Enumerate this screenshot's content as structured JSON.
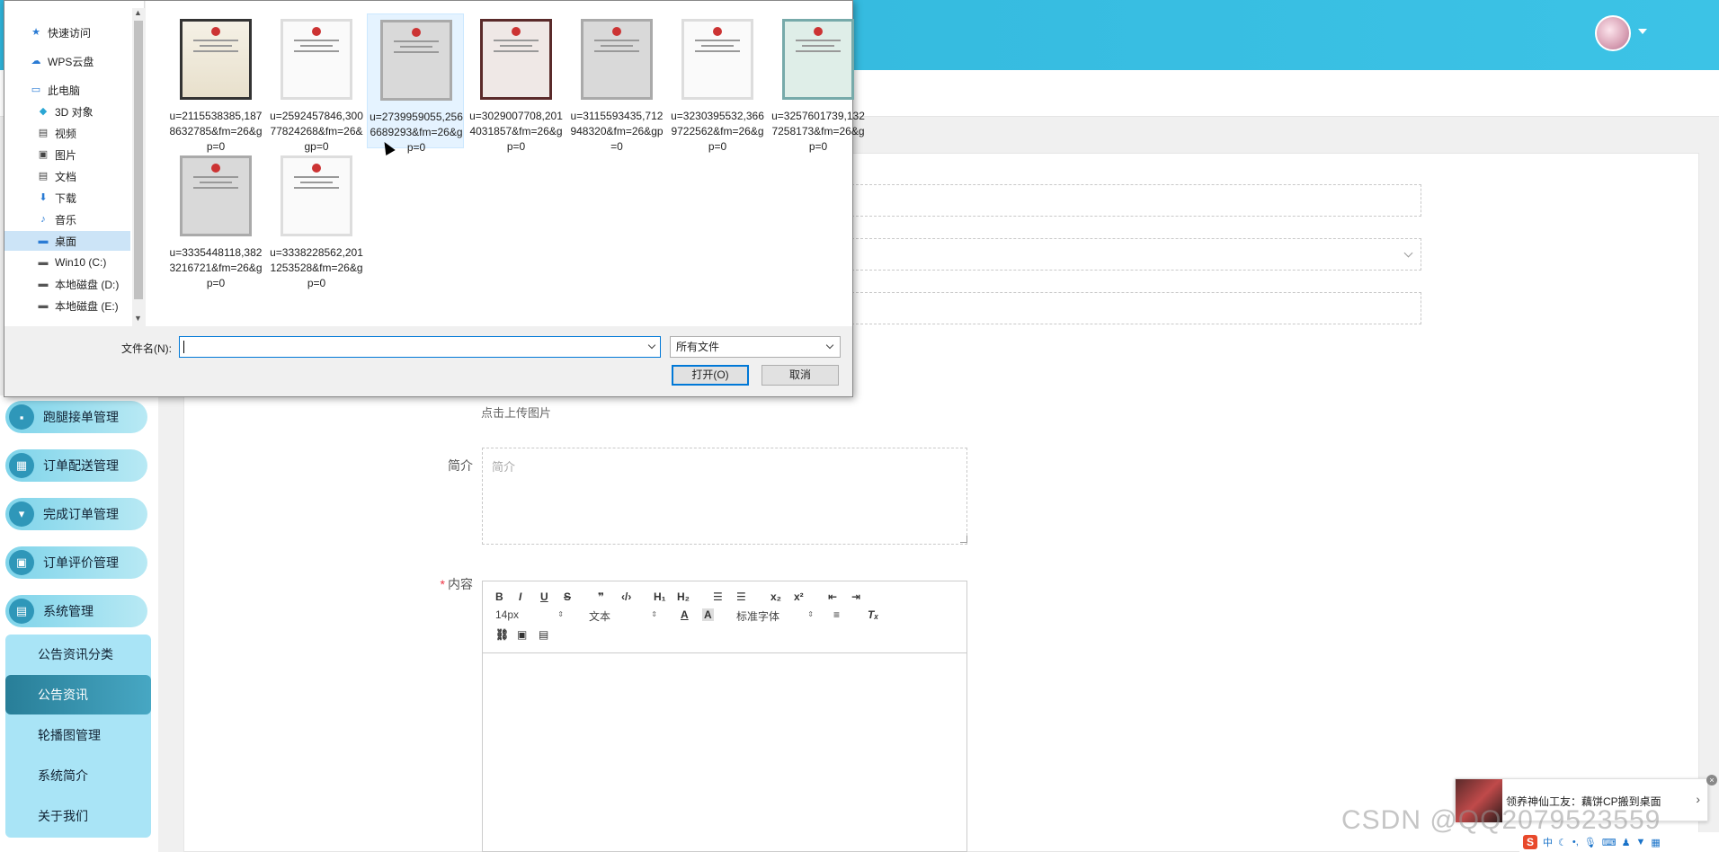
{
  "colors": {
    "header": "#2fb3d9",
    "accent": "#2f97b9",
    "submenu_bg": "#a9e4f6",
    "active_sub": "#287e98"
  },
  "sidebar": {
    "menu": [
      {
        "label": "跑腿接单管理",
        "icon": "chat-icon"
      },
      {
        "label": "订单配送管理",
        "icon": "grid-icon"
      },
      {
        "label": "完成订单管理",
        "icon": "stamp-icon"
      },
      {
        "label": "订单评价管理",
        "icon": "image-icon"
      },
      {
        "label": "系统管理",
        "icon": "document-icon"
      }
    ],
    "submenu": [
      {
        "label": "公告资讯分类"
      },
      {
        "label": "公告资讯"
      },
      {
        "label": "轮播图管理"
      },
      {
        "label": "系统简介"
      },
      {
        "label": "关于我们"
      }
    ]
  },
  "form": {
    "upload_hint": "点击上传图片",
    "intro_label": "简介",
    "intro_placeholder": "简介",
    "content_label": "内容",
    "required_mark": "*"
  },
  "editor": {
    "font_size": "14px",
    "text_style": "文本",
    "font_family": "标准字体"
  },
  "dialog": {
    "nav": [
      {
        "label": "快速访问",
        "icon": "star-icon"
      },
      {
        "label": "WPS云盘",
        "icon": "cloud-icon"
      },
      {
        "label": "此电脑",
        "icon": "computer-icon"
      },
      {
        "label": "3D 对象",
        "icon": "cube-icon"
      },
      {
        "label": "视频",
        "icon": "video-icon"
      },
      {
        "label": "图片",
        "icon": "picture-icon"
      },
      {
        "label": "文档",
        "icon": "document-icon"
      },
      {
        "label": "下载",
        "icon": "download-icon"
      },
      {
        "label": "音乐",
        "icon": "music-icon"
      },
      {
        "label": "桌面",
        "icon": "desktop-icon"
      },
      {
        "label": "Win10 (C:)",
        "icon": "drive-icon"
      },
      {
        "label": "本地磁盘 (D:)",
        "icon": "drive-icon"
      },
      {
        "label": "本地磁盘 (E:)",
        "icon": "drive-icon"
      }
    ],
    "files": [
      {
        "name": "u=2115538385,1878632785&fm=26&gp=0",
        "style": "dark-frame"
      },
      {
        "name": "u=2592457846,30077824268&fm=26&gp=0",
        "style": "light"
      },
      {
        "name": "u=2739959055,2566689293&fm=26&gp=0",
        "style": "gray"
      },
      {
        "name": "u=3029007708,2014031857&fm=26&gp=0",
        "style": "dark"
      },
      {
        "name": "u=3115593435,712948320&fm=26&gp=0",
        "style": "gray"
      },
      {
        "name": "u=3230395532,3669722562&fm=26&gp=0",
        "style": "light"
      },
      {
        "name": "u=3257601739,1327258173&fm=26&gp=0",
        "style": "green"
      },
      {
        "name": "u=3335448118,3823216721&fm=26&gp=0",
        "style": "gray"
      },
      {
        "name": "u=3338228562,2011253528&fm=26&gp=0",
        "style": "light"
      }
    ],
    "filename_label": "文件名(N):",
    "filename_value": "",
    "filter_value": "所有文件",
    "open_button": "打开(O)",
    "cancel_button": "取消"
  },
  "notification": {
    "text": "领养神仙工友：藕饼CP搬到桌面",
    "arrow": "›",
    "close": "×"
  },
  "watermark": "CSDN @QQ2079523559",
  "tray": {
    "ime_logo": "S",
    "ime_mode": "中"
  }
}
